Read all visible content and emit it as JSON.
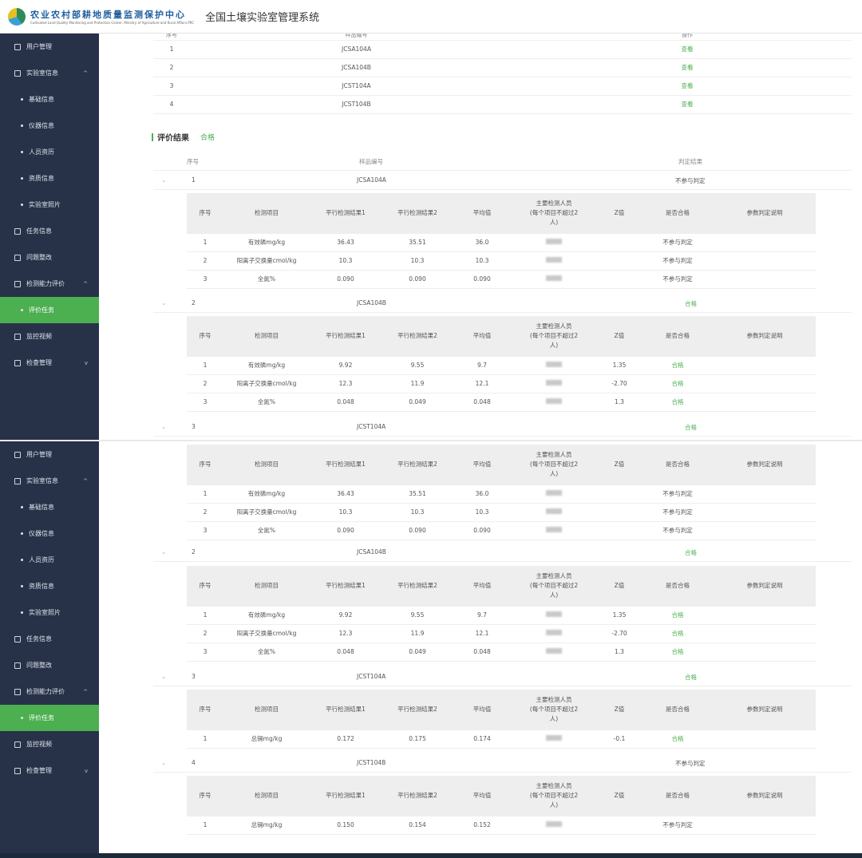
{
  "app": {
    "org_cn": "农业农村部耕地质量监测保护中心",
    "org_en": "Cultivated Land Quality Monitoring and Protection Center, Ministry of Agriculture and Rural Affairs,PRC",
    "title": "全国土壤实验室管理系统"
  },
  "sidebar": {
    "items": [
      {
        "label": "用户管理",
        "icon": "user-icon",
        "type": "top"
      },
      {
        "label": "实验室信息",
        "icon": "building-icon",
        "type": "top",
        "chev": "^"
      },
      {
        "label": "基础信息",
        "type": "sub"
      },
      {
        "label": "仪器信息",
        "type": "sub"
      },
      {
        "label": "人员资历",
        "type": "sub"
      },
      {
        "label": "资质信息",
        "type": "sub"
      },
      {
        "label": "实验室照片",
        "type": "sub"
      },
      {
        "label": "任务信息",
        "icon": "calendar-icon",
        "type": "top"
      },
      {
        "label": "问题整改",
        "icon": "checkbox-icon",
        "type": "top"
      },
      {
        "label": "检测能力评价",
        "icon": "chart-icon",
        "type": "top",
        "chev": "^"
      },
      {
        "label": "评价任务",
        "type": "sub",
        "active": true
      },
      {
        "label": "监控视频",
        "icon": "video-icon",
        "type": "top"
      },
      {
        "label": "检查管理",
        "icon": "clipboard-icon",
        "type": "top",
        "chev": "v"
      }
    ]
  },
  "samples_table": {
    "headers": [
      "序号",
      "样品编号",
      "操作"
    ],
    "rows": [
      [
        "1",
        "JCSA104A",
        "查看"
      ],
      [
        "2",
        "JCSA104B",
        "查看"
      ],
      [
        "3",
        "JCST104A",
        "查看"
      ],
      [
        "4",
        "JCST104B",
        "查看"
      ]
    ]
  },
  "eval": {
    "title": "评价结果",
    "status": "合格",
    "headers": [
      "序号",
      "样品编号",
      "判定结果"
    ],
    "inner_headers": [
      "序号",
      "检测项目",
      "平行检测结果1",
      "平行检测结果2",
      "平均值",
      "主要检测人员",
      "(每个项目不超过2",
      "人)",
      "Z值",
      "是否合格",
      "参数判定说明"
    ],
    "groups": [
      {
        "no": "1",
        "code": "JCSA104A",
        "result": "不参与判定",
        "rows": [
          [
            "1",
            "有效磷mg/kg",
            "36.43",
            "35.51",
            "36.0",
            "",
            "不参与判定"
          ],
          [
            "2",
            "阳离子交换量cmol/kg",
            "10.3",
            "10.3",
            "10.3",
            "",
            "不参与判定"
          ],
          [
            "3",
            "全氮%",
            "0.090",
            "0.090",
            "0.090",
            "",
            "不参与判定"
          ]
        ]
      },
      {
        "no": "2",
        "code": "JCSA104B",
        "result": "合格",
        "rows": [
          [
            "1",
            "有效磷mg/kg",
            "9.92",
            "9.55",
            "9.7",
            "1.35",
            "合格"
          ],
          [
            "2",
            "阳离子交换量cmol/kg",
            "12.3",
            "11.9",
            "12.1",
            "-2.70",
            "合格"
          ],
          [
            "3",
            "全氮%",
            "0.048",
            "0.049",
            "0.048",
            "1.3",
            "合格"
          ]
        ]
      },
      {
        "no": "3",
        "code": "JCST104A",
        "result": "合格",
        "rows": [
          [
            "1",
            "总镉mg/kg",
            "0.172",
            "0.175",
            "0.174",
            "-0.1",
            "合格"
          ]
        ]
      },
      {
        "no": "4",
        "code": "JCST104B",
        "result": "不参与判定",
        "rows": [
          [
            "1",
            "总镉mg/kg",
            "0.150",
            "0.154",
            "0.152",
            "",
            "不参与判定"
          ]
        ]
      }
    ]
  }
}
